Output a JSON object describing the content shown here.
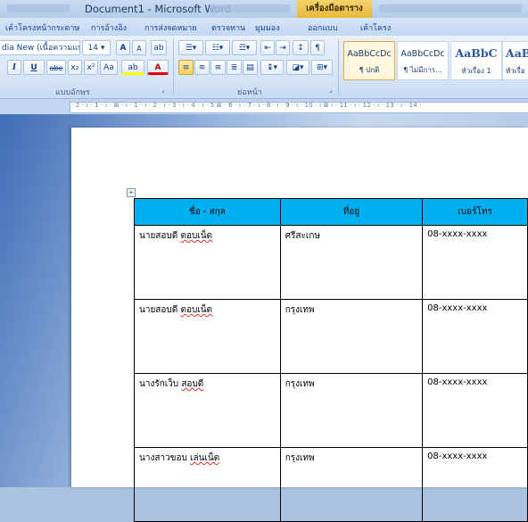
{
  "title_bar": {
    "document_title": "Document1 - Microsoft Word",
    "context_tab": "เครื่องมือตาราง"
  },
  "ribbon_tabs": [
    {
      "label": "เค้าโครงหน้ากระดาษ"
    },
    {
      "label": "การอ้างอิง"
    },
    {
      "label": "การส่งจดหมาย"
    },
    {
      "label": "ตรวจทาน"
    },
    {
      "label": "มุมมอง"
    },
    {
      "label": "ออกแบบ"
    },
    {
      "label": "เค้าโครง"
    }
  ],
  "font_group": {
    "font_name": "dia New (เนื้อความแบ",
    "font_size": "14",
    "grow_font": "A",
    "shrink_font": "A",
    "clear_format": "ab",
    "italic": "I",
    "underline": "U",
    "strike": "abe",
    "subscript": "x₂",
    "superscript": "x²",
    "change_case": "Aa",
    "highlight": "ab",
    "font_color": "A",
    "label": "แบบอักษร"
  },
  "paragraph_group": {
    "label": "ย่อหน้า"
  },
  "styles": [
    {
      "preview": "AaBbCcDc",
      "name": "¶ ปกติ",
      "selected": true,
      "big": false
    },
    {
      "preview": "AaBbCcDc",
      "name": "¶ ไม่มีการ...",
      "selected": false,
      "big": false
    },
    {
      "preview": "AaBbC",
      "name": "หัวเรื่อง 1",
      "selected": false,
      "big": true
    },
    {
      "preview": "AaBl",
      "name": "หัวเรื่อ",
      "selected": false,
      "big": true
    }
  ],
  "ruler": {
    "marks": "· 2 · ı · 1 · ı · ⊞ · ı · 1 · ı · 2 · ı · 3 · ı · 4 · ı · 5 ⊞ · 6 · ı · 7 · ı · 8 · ı · 9 · ı · 10 · ı ⊞ ı · 11 · ı · 12 · ı · 13 · ı · 14 ·"
  },
  "table": {
    "headers": [
      "ชื่อ - สกุล",
      "ที่อยู่",
      "เบอร์โทร"
    ],
    "rows": [
      [
        "นายสอบดี ตอบเน็ต",
        "ศรีสะเกษ",
        "08-xxxx-xxxx"
      ],
      [
        "นายสอบดี ตอบเน็ต",
        "กรุงเทพ",
        "08-xxxx-xxxx"
      ],
      [
        "นางรักเว็บ สอบดี",
        "กรุงเทพ",
        "08-xxxx-xxxx"
      ],
      [
        "นางสาวขอบ เล่นเน็ต",
        "กรุงเทพ",
        "08-xxxx-xxxx"
      ]
    ]
  },
  "colors": {
    "header_fill": "#00b0f0",
    "context_tab": "#f0c24e"
  }
}
